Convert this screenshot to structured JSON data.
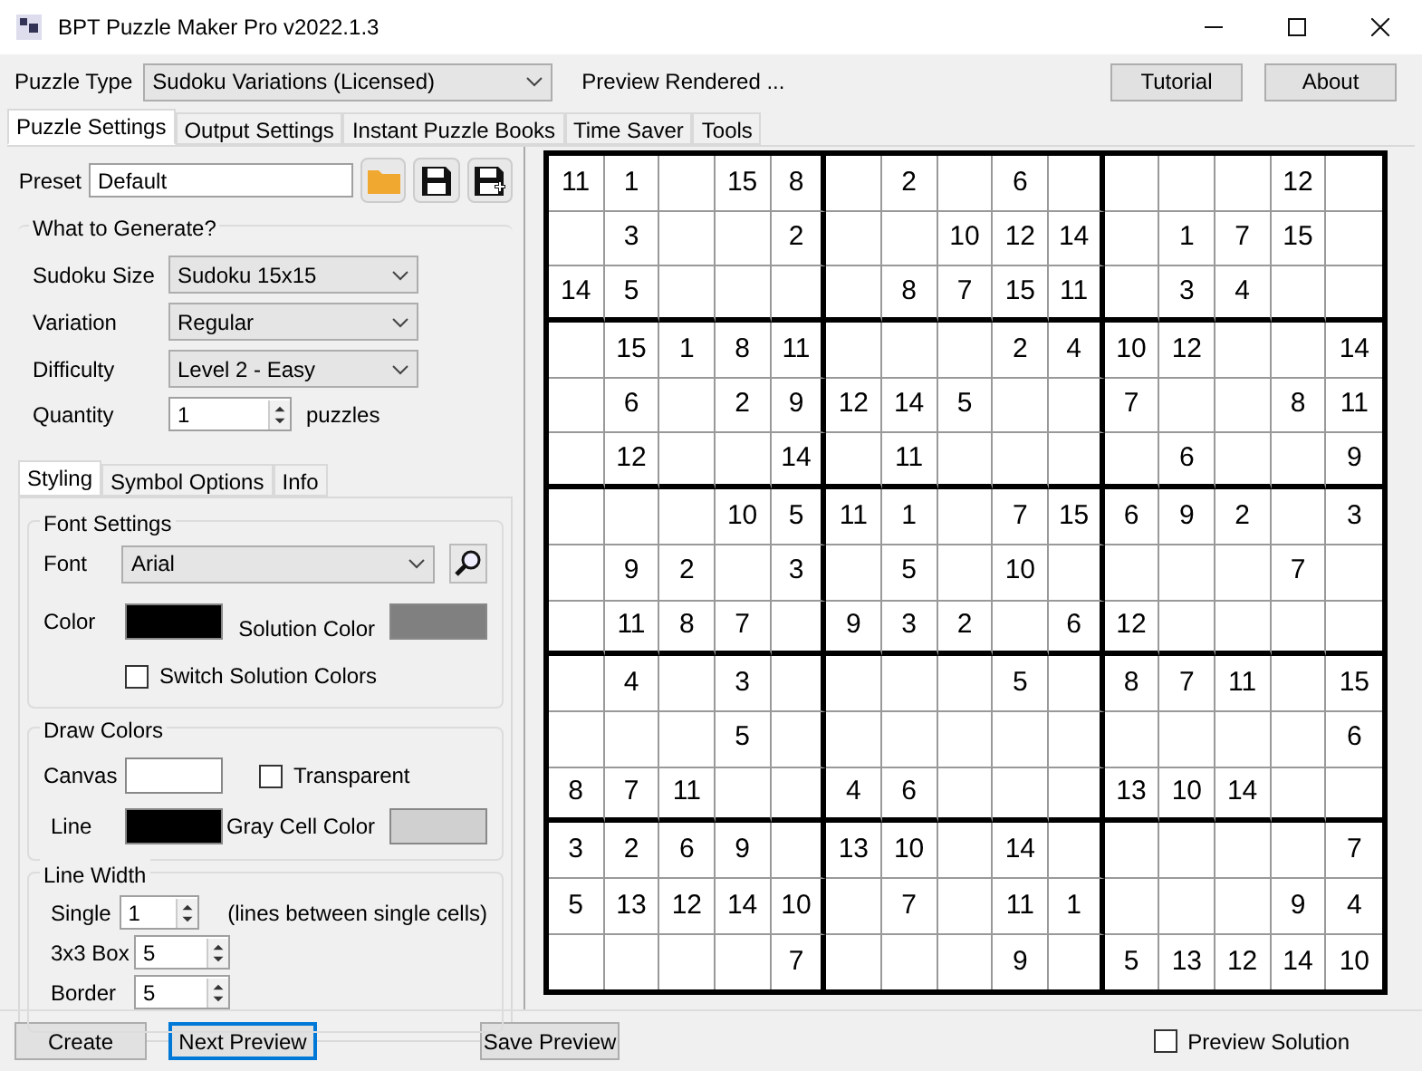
{
  "window": {
    "title": "BPT Puzzle Maker Pro v2022.1.3"
  },
  "toolbar": {
    "puzzle_type_label": "Puzzle Type",
    "puzzle_type_value": "Sudoku Variations (Licensed)",
    "status": "Preview Rendered ...",
    "buttons": [
      "Tutorial",
      "About"
    ]
  },
  "tabs": [
    {
      "label": "Puzzle Settings",
      "selected": true
    },
    {
      "label": "Output Settings",
      "selected": false
    },
    {
      "label": "Instant Puzzle Books",
      "selected": false
    },
    {
      "label": "Time Saver",
      "selected": false
    },
    {
      "label": "Tools",
      "selected": false
    }
  ],
  "preset": {
    "label": "Preset",
    "value": "Default"
  },
  "generate": {
    "title": "What to Generate?",
    "fields": [
      {
        "label": "Sudoku Size",
        "value": "Sudoku 15x15",
        "kind": "dropdown"
      },
      {
        "label": "Variation",
        "value": "Regular",
        "kind": "dropdown"
      },
      {
        "label": "Difficulty",
        "value": "Level 2 - Easy",
        "kind": "dropdown"
      },
      {
        "label": "Quantity",
        "value": "1",
        "kind": "spinner",
        "suffix": "puzzles"
      }
    ]
  },
  "sub_tabs": [
    {
      "label": "Styling",
      "selected": true
    },
    {
      "label": "Symbol Options",
      "selected": false
    },
    {
      "label": "Info",
      "selected": false
    }
  ],
  "font_settings": {
    "title": "Font Settings",
    "font_label": "Font",
    "font_value": "Arial",
    "swatches": [
      {
        "label": "Color",
        "color": "#000000"
      },
      {
        "label": "Solution Color",
        "color": "#808080"
      }
    ],
    "checkbox": {
      "label": "Switch Solution Colors",
      "checked": false
    }
  },
  "draw_colors": {
    "title": "Draw Colors",
    "swatches": [
      {
        "label": "Canvas",
        "color": "#ffffff"
      },
      {
        "label": "Line",
        "color": "#000000"
      }
    ],
    "checkbox": {
      "label": "Transparent",
      "checked": false
    },
    "gray_cell": {
      "label": "Gray Cell Color",
      "color": "#d0d0d0"
    }
  },
  "line_width": {
    "title": "Line Width",
    "fields": [
      {
        "label": "Single",
        "value": "1"
      },
      {
        "label": "3x3 Box",
        "value": "5"
      },
      {
        "label": "Border",
        "value": "5"
      }
    ],
    "note": "(lines between single cells)"
  },
  "puzzle": {
    "rows": [
      [
        "11",
        "1",
        null,
        "15",
        "8",
        null,
        "2",
        null,
        "6",
        null,
        null,
        null,
        null,
        "12",
        null
      ],
      [
        null,
        "3",
        null,
        null,
        "2",
        null,
        null,
        "10",
        "12",
        "14",
        null,
        "1",
        "7",
        "15",
        null
      ],
      [
        "14",
        "5",
        null,
        null,
        null,
        null,
        "8",
        "7",
        "15",
        "11",
        null,
        "3",
        "4",
        null,
        null
      ],
      [
        null,
        "15",
        "1",
        "8",
        "11",
        null,
        null,
        null,
        "2",
        "4",
        "10",
        "12",
        null,
        null,
        "14"
      ],
      [
        null,
        "6",
        null,
        "2",
        "9",
        "12",
        "14",
        "5",
        null,
        null,
        "7",
        null,
        null,
        "8",
        "11"
      ],
      [
        null,
        "12",
        null,
        null,
        "14",
        null,
        "11",
        null,
        null,
        null,
        null,
        "6",
        null,
        null,
        "9"
      ],
      [
        null,
        null,
        null,
        "10",
        "5",
        "11",
        "1",
        null,
        "7",
        "15",
        "6",
        "9",
        "2",
        null,
        "3"
      ],
      [
        null,
        "9",
        "2",
        null,
        "3",
        null,
        "5",
        null,
        "10",
        null,
        null,
        null,
        null,
        "7",
        null
      ],
      [
        null,
        "11",
        "8",
        "7",
        null,
        "9",
        "3",
        "2",
        null,
        "6",
        "12",
        null,
        null,
        null,
        null
      ],
      [
        null,
        "4",
        null,
        "3",
        null,
        null,
        null,
        null,
        "5",
        null,
        "8",
        "7",
        "11",
        null,
        "15"
      ],
      [
        null,
        null,
        null,
        "5",
        null,
        null,
        null,
        null,
        null,
        null,
        null,
        null,
        null,
        null,
        "6"
      ],
      [
        "8",
        "7",
        "11",
        null,
        null,
        "4",
        "6",
        null,
        null,
        null,
        "13",
        "10",
        "14",
        null,
        null
      ],
      [
        "3",
        "2",
        "6",
        "9",
        null,
        "13",
        "10",
        null,
        "14",
        null,
        null,
        null,
        null,
        null,
        "7"
      ],
      [
        "5",
        "13",
        "12",
        "14",
        "10",
        null,
        "7",
        null,
        "11",
        "1",
        null,
        null,
        null,
        "9",
        "4"
      ],
      [
        null,
        null,
        null,
        null,
        "7",
        null,
        null,
        null,
        "9",
        null,
        "5",
        "13",
        "12",
        "14",
        "10"
      ]
    ]
  },
  "bottom": {
    "buttons": [
      {
        "label": "Create",
        "focused": false
      },
      {
        "label": "Next Preview",
        "focused": true
      },
      {
        "label": "Save Preview",
        "focused": false
      }
    ],
    "preview_solution": {
      "label": "Preview Solution",
      "checked": false
    }
  }
}
